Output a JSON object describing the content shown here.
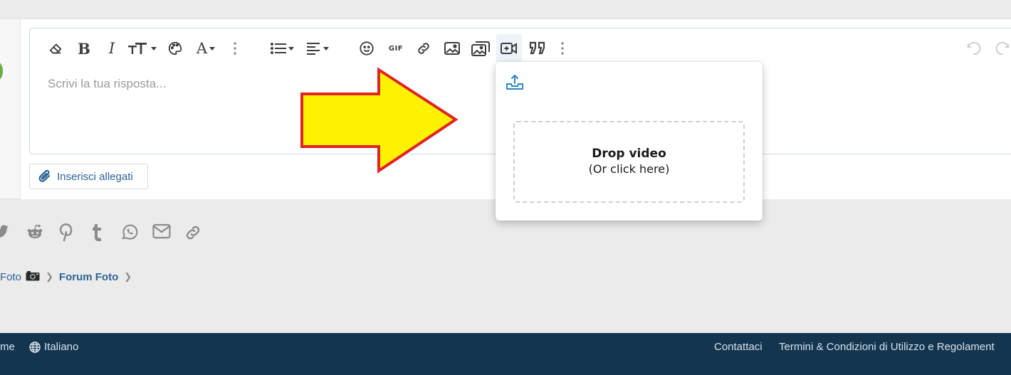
{
  "editor": {
    "placeholder": "Scrivi la tua risposta...",
    "toolbar": [
      {
        "name": "remove-format-icon"
      },
      {
        "name": "bold-icon",
        "label": "B"
      },
      {
        "name": "italic-icon",
        "label": "I"
      },
      {
        "name": "text-size-icon"
      },
      {
        "name": "palette-icon"
      },
      {
        "name": "font-icon",
        "label": "A"
      },
      {
        "name": "more-vertical-icon"
      },
      {
        "name": "list-icon"
      },
      {
        "name": "align-icon"
      },
      {
        "name": "smiley-icon"
      },
      {
        "name": "gif-icon",
        "label": "GIF"
      },
      {
        "name": "link-icon"
      },
      {
        "name": "image-icon"
      },
      {
        "name": "gallery-icon"
      },
      {
        "name": "video-icon"
      },
      {
        "name": "quote-icon"
      },
      {
        "name": "more-vertical-icon"
      },
      {
        "name": "undo-icon"
      },
      {
        "name": "redo-icon"
      }
    ]
  },
  "attachments": {
    "label": "Inserisci allegati"
  },
  "video_popup": {
    "drop_title": "Drop video",
    "drop_hint": "(Or click here)"
  },
  "share": [
    "twitter-icon",
    "reddit-icon",
    "pinterest-icon",
    "tumblr-icon",
    "whatsapp-icon",
    "email-icon",
    "link-icon"
  ],
  "breadcrumb": [
    {
      "label": "Foto"
    },
    {
      "label": "Forum Foto"
    }
  ],
  "footer": {
    "left_partial": "me",
    "language": "Italiano",
    "contact": "Contattaci",
    "terms": "Termini & Condizioni di Utilizzo e Regolament"
  },
  "colors": {
    "accent": "#2b6596",
    "footer_bg": "#133550",
    "arrow_fill": "#fff200",
    "arrow_stroke": "#e02424"
  }
}
